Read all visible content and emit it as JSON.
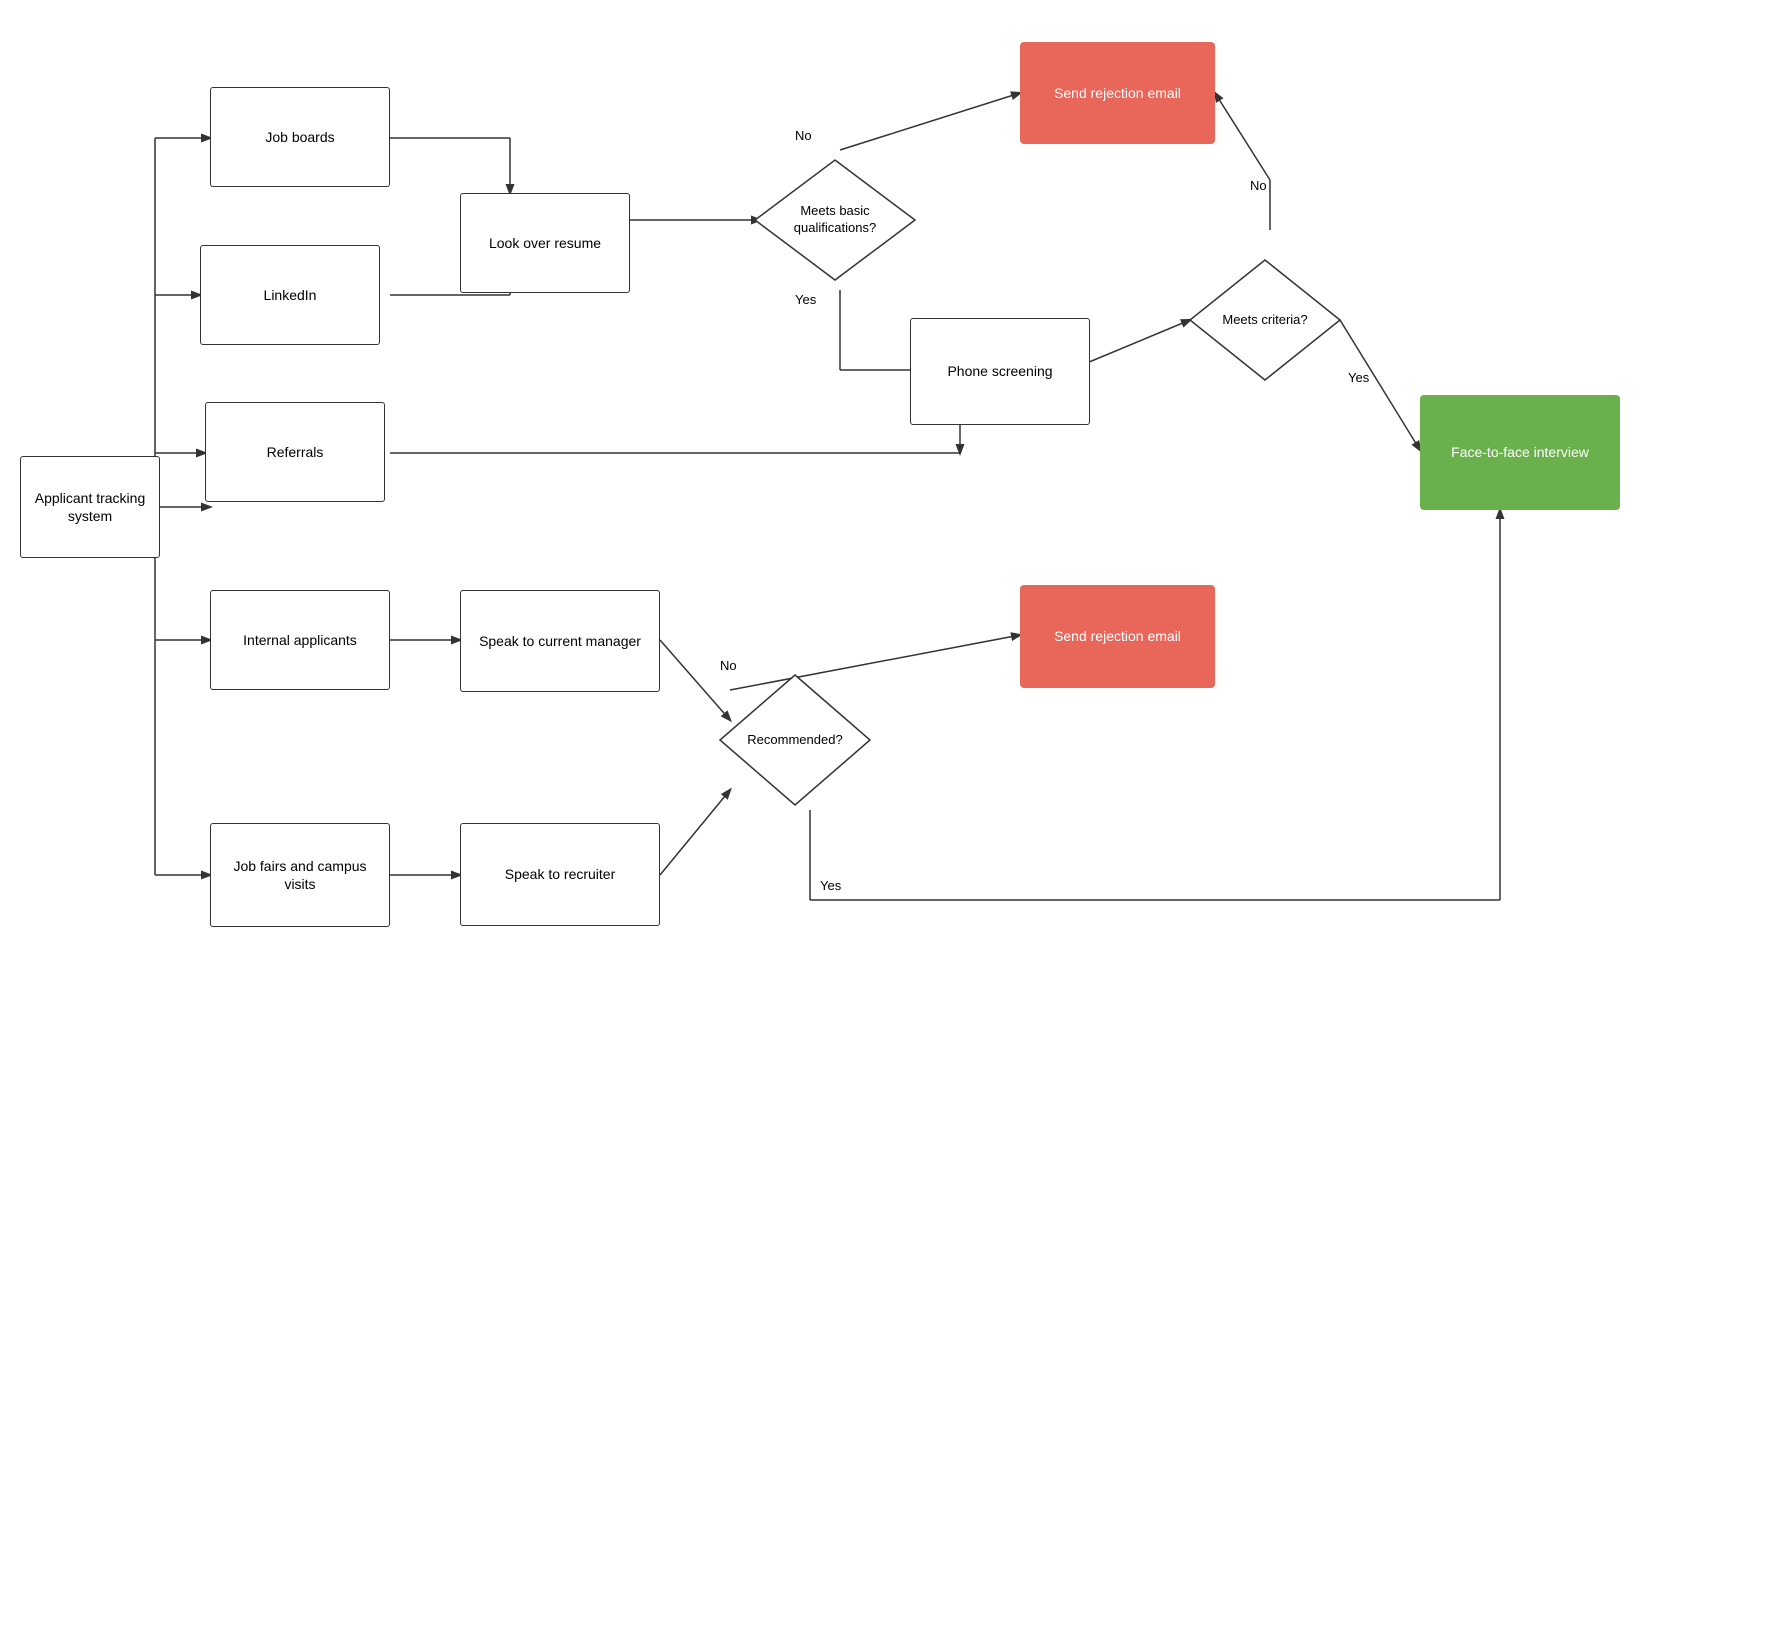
{
  "nodes": {
    "applicant_tracking": {
      "label": "Applicant tracking system"
    },
    "job_boards": {
      "label": "Job boards"
    },
    "linkedin": {
      "label": "LinkedIn"
    },
    "referrals": {
      "label": "Referrals"
    },
    "internal_applicants": {
      "label": "Internal applicants"
    },
    "job_fairs": {
      "label": "Job fairs and campus visits"
    },
    "look_over_resume": {
      "label": "Look over resume"
    },
    "phone_screening": {
      "label": "Phone screening"
    },
    "speak_to_current_manager": {
      "label": "Speak to current manager"
    },
    "speak_to_recruiter": {
      "label": "Speak to recruiter"
    },
    "send_rejection_email_1": {
      "label": "Send rejection email"
    },
    "send_rejection_email_2": {
      "label": "Send rejection email"
    },
    "face_to_face": {
      "label": "Face-to-face interview"
    },
    "meets_basic_qual": {
      "label": "Meets basic qualifications?"
    },
    "meets_criteria": {
      "label": "Meets criteria?"
    },
    "recommended": {
      "label": "Recommended?"
    }
  },
  "labels": {
    "yes": "Yes",
    "no": "No"
  }
}
